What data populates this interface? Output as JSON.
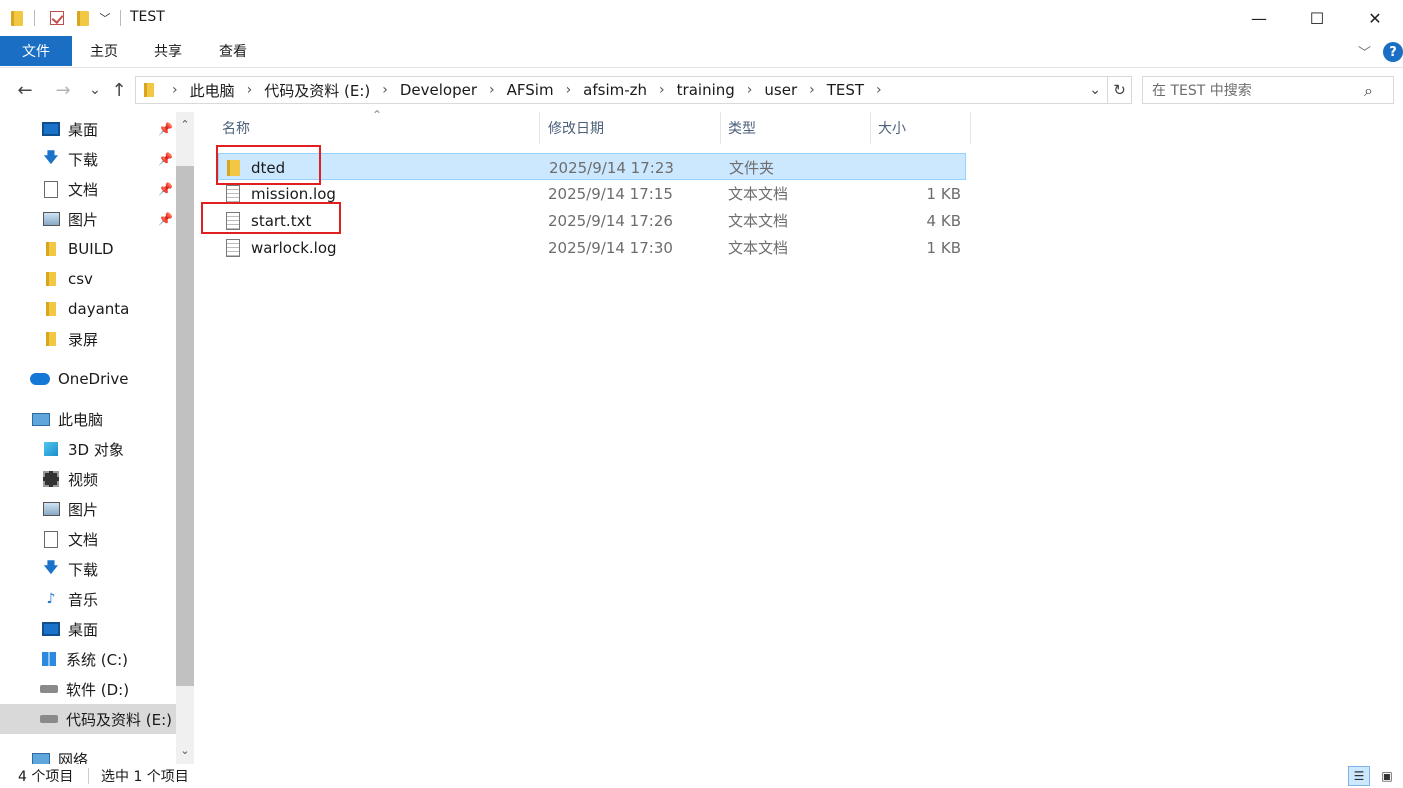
{
  "window": {
    "title": "TEST",
    "minimize_glyph": "—",
    "maximize_glyph": "☐",
    "close_glyph": "✕"
  },
  "ribbon": {
    "tabs": [
      {
        "label": "文件"
      },
      {
        "label": "主页"
      },
      {
        "label": "共享"
      },
      {
        "label": "查看"
      }
    ],
    "expand_glyph": "﹀",
    "help_glyph": "?"
  },
  "nav": {
    "back_glyph": "←",
    "forward_glyph": "→",
    "recent_glyph": "⌄",
    "up_glyph": "↑",
    "breadcrumbs": [
      "此电脑",
      "代码及资料 (E:)",
      "Developer",
      "AFSim",
      "afsim-zh",
      "training",
      "user",
      "TEST"
    ],
    "breadcrumb_separator": "›",
    "dropdown_glyph": "⌄",
    "refresh_glyph": "↻",
    "search_placeholder": "在 TEST 中搜索",
    "search_glyph": "⌕"
  },
  "sidebar": {
    "pin_glyph": "📌",
    "items": [
      {
        "label": "桌面",
        "icon": "desktop-icon",
        "pinned": true
      },
      {
        "label": "下载",
        "icon": "download-icon",
        "pinned": true
      },
      {
        "label": "文档",
        "icon": "document-icon",
        "pinned": true
      },
      {
        "label": "图片",
        "icon": "pictures-icon",
        "pinned": true
      },
      {
        "label": "BUILD",
        "icon": "folder-icon"
      },
      {
        "label": "csv",
        "icon": "folder-icon"
      },
      {
        "label": "dayanta",
        "icon": "folder-icon"
      },
      {
        "label": "录屏",
        "icon": "folder-icon"
      },
      {
        "label": "OneDrive",
        "icon": "onedrive-icon"
      },
      {
        "label": "此电脑",
        "icon": "this-pc-icon"
      },
      {
        "label": "3D 对象",
        "icon": "3d-objects-icon"
      },
      {
        "label": "视频",
        "icon": "videos-icon"
      },
      {
        "label": "图片",
        "icon": "pictures-icon"
      },
      {
        "label": "文档",
        "icon": "document-icon"
      },
      {
        "label": "下载",
        "icon": "download-icon"
      },
      {
        "label": "音乐",
        "icon": "music-icon"
      },
      {
        "label": "桌面",
        "icon": "desktop-icon"
      },
      {
        "label": "系统 (C:)",
        "icon": "windows-drive-icon"
      },
      {
        "label": "软件 (D:)",
        "icon": "drive-icon"
      },
      {
        "label": "代码及资料 (E:)",
        "icon": "drive-icon",
        "selected": true
      },
      {
        "label": "网络",
        "icon": "network-icon"
      }
    ],
    "scroll_up_glyph": "⌃",
    "scroll_down_glyph": "⌄"
  },
  "columns": {
    "name": "名称",
    "date": "修改日期",
    "type": "类型",
    "size": "大小",
    "sort_glyph": "⌃"
  },
  "files": [
    {
      "name": "dted",
      "date": "2025/9/14 17:23",
      "type": "文件夹",
      "size": "",
      "icon": "folder-icon",
      "selected": true,
      "highlighted": true
    },
    {
      "name": "mission.log",
      "date": "2025/9/14 17:15",
      "type": "文本文档",
      "size": "1 KB",
      "icon": "text-file-icon"
    },
    {
      "name": "start.txt",
      "date": "2025/9/14 17:26",
      "type": "文本文档",
      "size": "4 KB",
      "icon": "text-file-icon",
      "highlighted": true
    },
    {
      "name": "warlock.log",
      "date": "2025/9/14 17:30",
      "type": "文本文档",
      "size": "1 KB",
      "icon": "text-file-icon"
    }
  ],
  "status": {
    "item_count": "4 个项目",
    "selection": "选中 1 个项目",
    "details_view_glyph": "☰",
    "large_icons_glyph": "▣"
  },
  "colors": {
    "accent": "#1a6fc4",
    "selection": "#cce8ff",
    "highlight_box": "#e02020"
  }
}
